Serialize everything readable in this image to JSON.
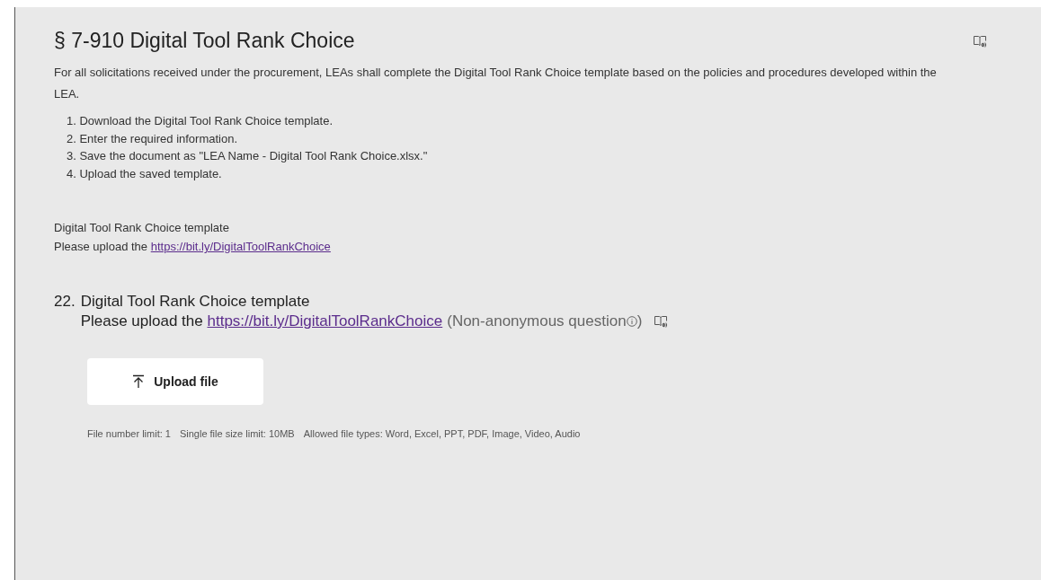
{
  "section": {
    "title": "§ 7-910 Digital Tool Rank Choice",
    "intro": "For all solicitations received under the procurement, LEAs shall complete the Digital Tool Rank Choice template based on the policies and procedures developed within the LEA.",
    "steps": [
      "1. Download the Digital Tool Rank Choice template.",
      "2. Enter the required information.",
      "3. Save the document as \"LEA Name - Digital Tool Rank Choice.xlsx.\"",
      "4. Upload the saved template."
    ],
    "template_title": "Digital Tool Rank Choice template",
    "template_prompt": "Please upload the",
    "template_link": "https://bit.ly/DigitalToolRankChoice"
  },
  "question": {
    "number": "22.",
    "title": "Digital Tool Rank Choice template",
    "prompt": "Please upload the",
    "link": "https://bit.ly/DigitalToolRankChoice",
    "note": "(Non-anonymous question",
    "note_end": ")",
    "upload_label": "Upload file",
    "limits": [
      "File number limit: 1",
      "Single file size limit: 10MB",
      "Allowed file types: Word, Excel, PPT, PDF, Image, Video, Audio"
    ]
  }
}
